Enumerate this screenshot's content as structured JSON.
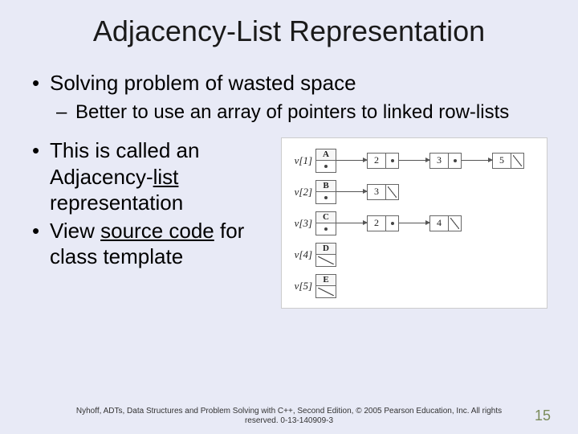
{
  "title": "Adjacency-List Representation",
  "bullet1": "Solving problem of wasted space",
  "sub1": "Better to use an array of pointers to linked row-lists",
  "bullet2a": "This is called an Adjacency-",
  "bullet2b_underlined": "list",
  "bullet2c": " representation",
  "bullet3a": "View ",
  "bullet3b_underlined": "source code",
  "bullet3c": " for class template",
  "diagram": {
    "rows": [
      {
        "label": "v[1]",
        "head": "A",
        "nodes": [
          "2",
          "3",
          "5"
        ]
      },
      {
        "label": "v[2]",
        "head": "B",
        "nodes": [
          "3"
        ]
      },
      {
        "label": "v[3]",
        "head": "C",
        "nodes": [
          "2",
          "4"
        ]
      },
      {
        "label": "v[4]",
        "head": "D",
        "nodes": []
      },
      {
        "label": "v[5]",
        "head": "E",
        "nodes": []
      }
    ]
  },
  "footer": "Nyhoff, ADTs, Data Structures and Problem Solving with C++, Second Edition, © 2005 Pearson Education, Inc. All rights reserved. 0-13-140909-3",
  "pagenum": "15"
}
